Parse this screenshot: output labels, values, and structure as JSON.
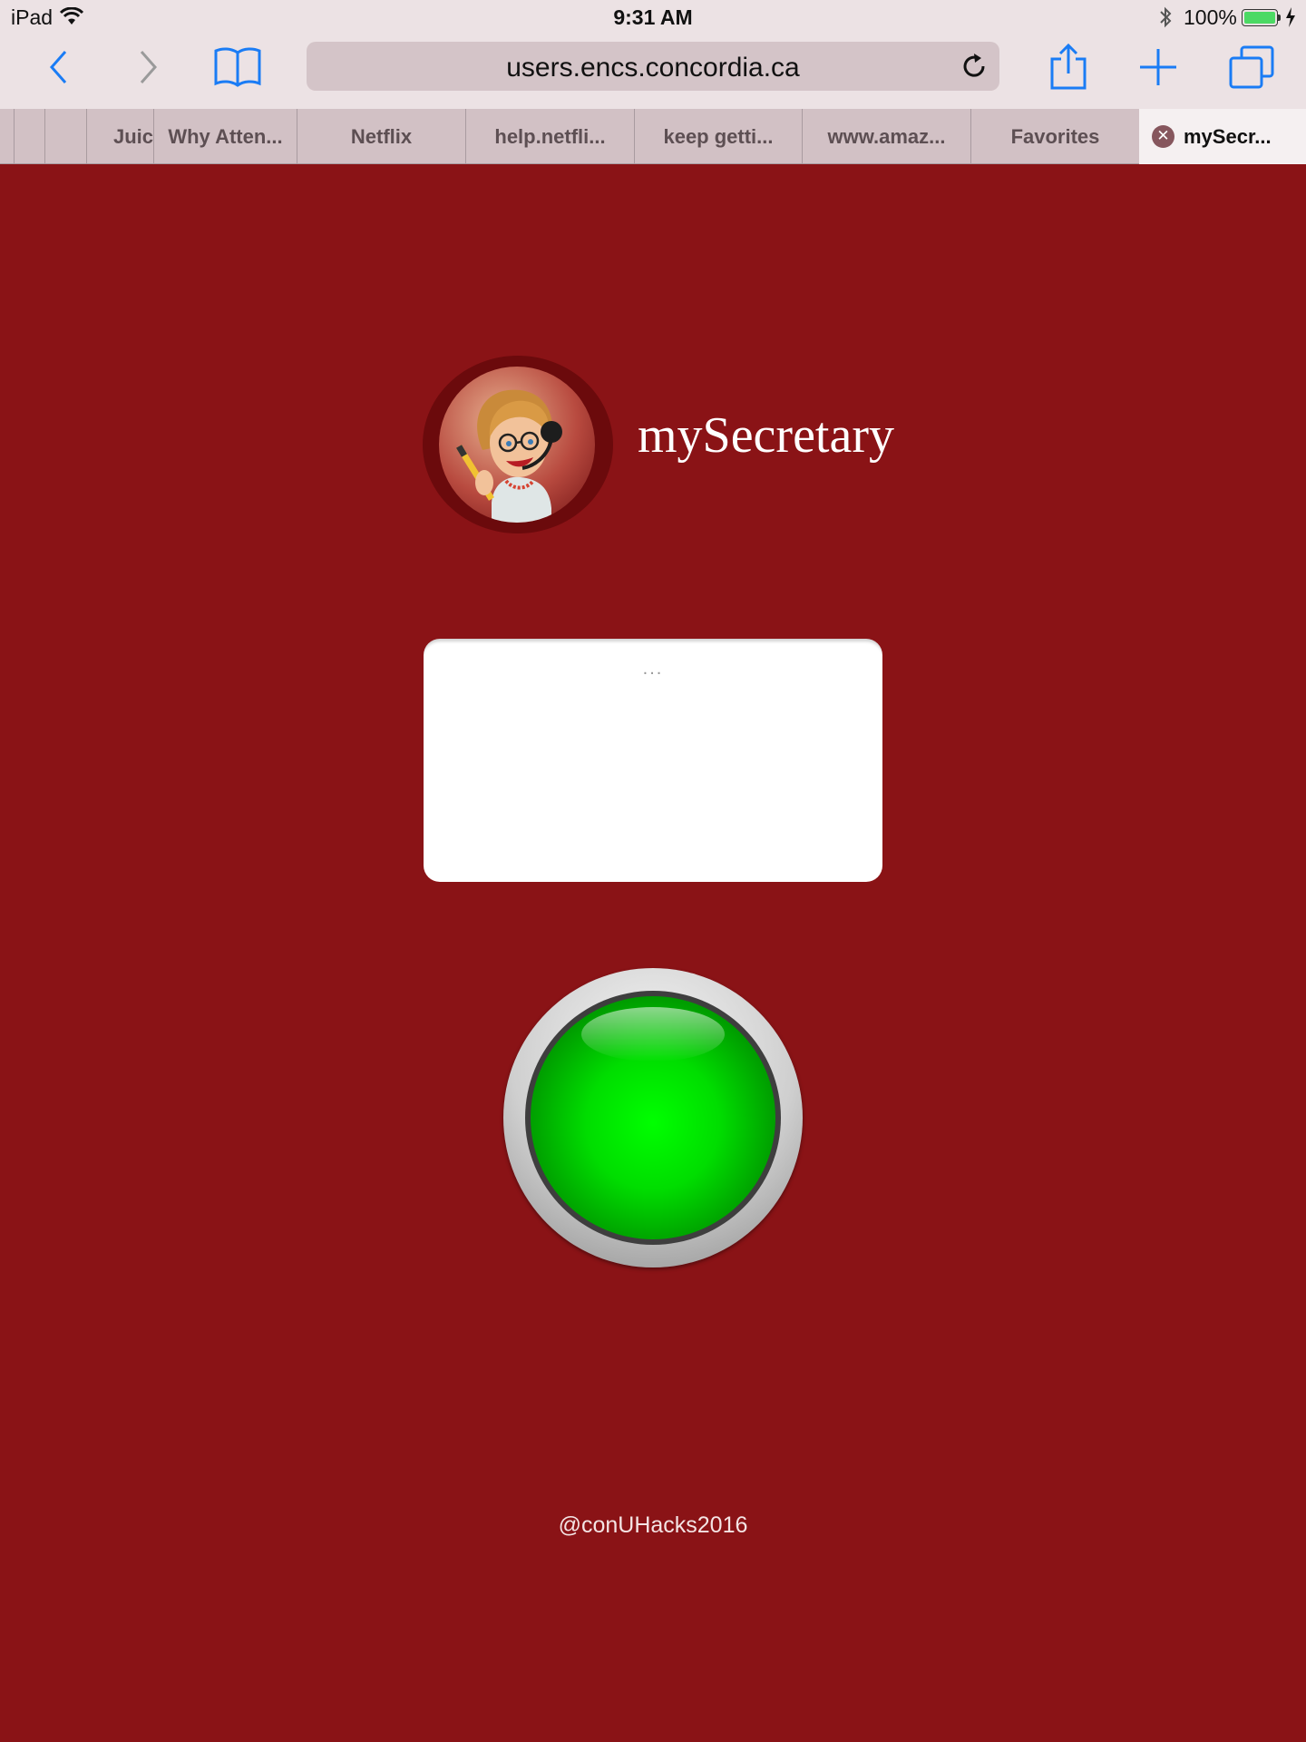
{
  "status_bar": {
    "device": "iPad",
    "time": "9:31 AM",
    "battery": "100%",
    "battery_level": 1.0,
    "icons": [
      "wifi-icon",
      "bluetooth-icon",
      "battery-icon",
      "charging-icon"
    ]
  },
  "toolbar": {
    "url": "users.encs.concordia.ca",
    "icons": [
      "back-icon",
      "forward-icon",
      "bookmarks-icon",
      "reload-icon",
      "share-icon",
      "new-tab-icon",
      "tabs-icon"
    ]
  },
  "tabs": [
    {
      "label": ""
    },
    {
      "label": ""
    },
    {
      "label": "Juic"
    },
    {
      "label": "Why Atten..."
    },
    {
      "label": "Netflix"
    },
    {
      "label": "help.netfli..."
    },
    {
      "label": "keep getti..."
    },
    {
      "label": "www.amaz..."
    },
    {
      "label": "Favorites"
    },
    {
      "label": "mySecr...",
      "active": true
    }
  ],
  "app": {
    "title": "mySecretary",
    "message_placeholder": "...",
    "footer": "@conUHacks2016"
  },
  "colors": {
    "page_background": "#8a1316",
    "toolbar_background": "#ece2e4",
    "ios_blue": "#1a7cf5",
    "button_green": "#00ff00"
  }
}
